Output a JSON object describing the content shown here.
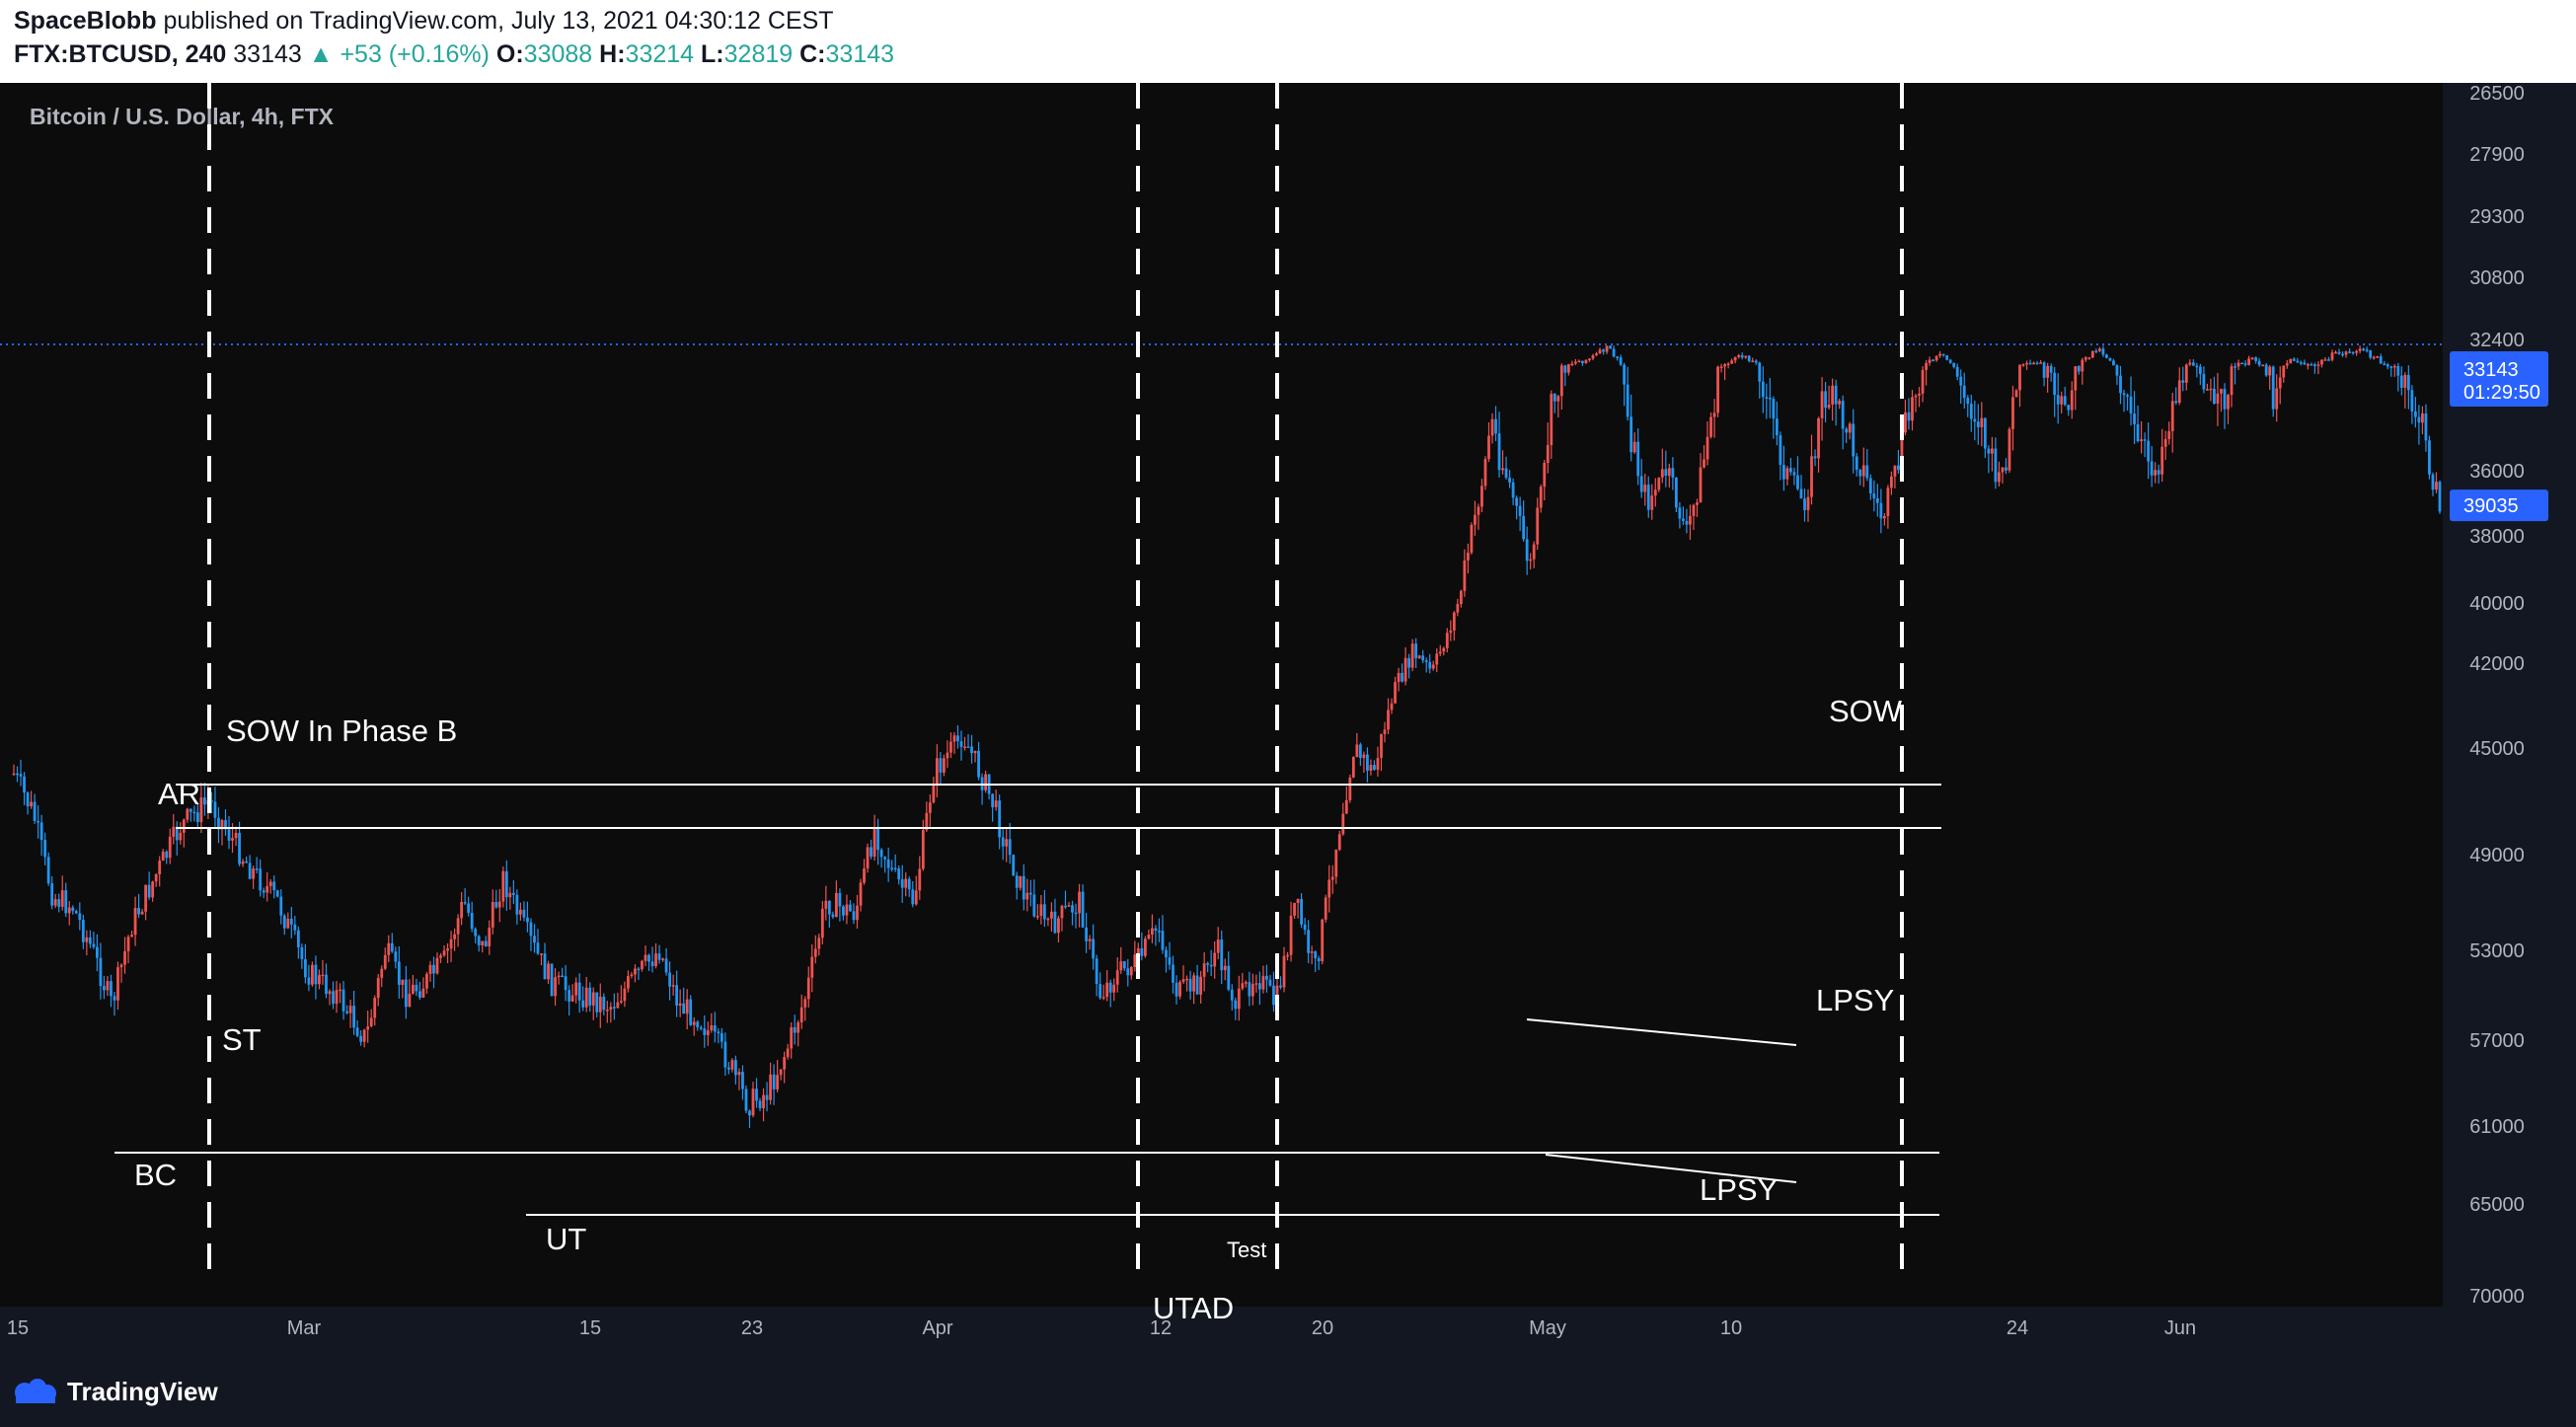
{
  "header": {
    "author": "SpaceBlobb",
    "published_text": "published on TradingView.com, July 13, 2021 04:30:12 CEST",
    "symbol": "FTX:BTCUSD, 240",
    "last": "33143",
    "change": "▲ +53 (+0.16%)",
    "o_label": "O:",
    "o_value": "33088",
    "h_label": "H:",
    "h_value": "33214",
    "l_label": "L:",
    "l_value": "32819",
    "c_label": "C:",
    "c_value": "33143"
  },
  "chart_data": {
    "type": "candlestick",
    "title": "Bitcoin / U.S. Dollar, 4h, FTX",
    "y_axis_inverted": true,
    "y_ticks": [
      26500,
      27900,
      29300,
      30800,
      32400,
      36000,
      38000,
      40000,
      42000,
      45000,
      49000,
      53000,
      57000,
      61000,
      65000,
      70000
    ],
    "x_ticks": [
      "15",
      "Mar",
      "15",
      "23",
      "Apr",
      "12",
      "20",
      "May",
      "10",
      "24",
      "Jun"
    ],
    "current_price": {
      "value": "33143",
      "countdown": "01:29:50"
    },
    "marker_price": "39035",
    "price_waypoints": [
      [
        0,
        50000
      ],
      [
        0.02,
        51500
      ],
      [
        0.04,
        54800
      ],
      [
        0.06,
        55200
      ],
      [
        0.08,
        57000
      ],
      [
        0.1,
        59500
      ],
      [
        0.12,
        56000
      ],
      [
        0.15,
        53500
      ],
      [
        0.17,
        52000
      ],
      [
        0.2,
        51000
      ],
      [
        0.24,
        53500
      ],
      [
        0.27,
        55000
      ],
      [
        0.3,
        58000
      ],
      [
        0.33,
        59000
      ],
      [
        0.36,
        61000
      ],
      [
        0.38,
        57000
      ],
      [
        0.4,
        59000
      ],
      [
        0.42,
        58500
      ],
      [
        0.44,
        57500
      ],
      [
        0.46,
        55000
      ],
      [
        0.48,
        57000
      ],
      [
        0.5,
        54000
      ],
      [
        0.52,
        56000
      ],
      [
        0.55,
        58500
      ],
      [
        0.58,
        59000
      ],
      [
        0.61,
        59500
      ],
      [
        0.64,
        58000
      ],
      [
        0.66,
        57000
      ],
      [
        0.68,
        59500
      ],
      [
        0.7,
        60000
      ],
      [
        0.73,
        62000
      ],
      [
        0.75,
        64000
      ],
      [
        0.77,
        63500
      ],
      [
        0.79,
        61500
      ],
      [
        0.81,
        59000
      ],
      [
        0.83,
        55000
      ],
      [
        0.86,
        55500
      ],
      [
        0.88,
        52000
      ],
      [
        0.9,
        54000
      ],
      [
        0.92,
        55000
      ],
      [
        0.94,
        50000
      ],
      [
        0.97,
        48500
      ],
      [
        1.0,
        51000
      ],
      [
        1.03,
        54500
      ],
      [
        1.06,
        56000
      ],
      [
        1.09,
        55000
      ],
      [
        1.11,
        59000
      ],
      [
        1.13,
        58000
      ],
      [
        1.15,
        57500
      ],
      [
        1.17,
        56000
      ],
      [
        1.19,
        59000
      ],
      [
        1.21,
        58500
      ],
      [
        1.23,
        57000
      ],
      [
        1.25,
        59500
      ],
      [
        1.27,
        58000
      ],
      [
        1.29,
        59500
      ],
      [
        1.31,
        55000
      ],
      [
        1.33,
        58000
      ],
      [
        1.35,
        53000
      ],
      [
        1.37,
        49000
      ],
      [
        1.39,
        50000
      ],
      [
        1.41,
        46500
      ],
      [
        1.43,
        44500
      ],
      [
        1.45,
        45500
      ],
      [
        1.47,
        43000
      ],
      [
        1.49,
        40000
      ],
      [
        1.51,
        37000
      ],
      [
        1.53,
        38500
      ],
      [
        1.55,
        41000
      ],
      [
        1.57,
        37000
      ],
      [
        1.59,
        35500
      ],
      [
        1.61,
        35000
      ],
      [
        1.63,
        33500
      ],
      [
        1.65,
        37000
      ],
      [
        1.67,
        39000
      ],
      [
        1.69,
        38000
      ],
      [
        1.71,
        40000
      ],
      [
        1.73,
        37500
      ],
      [
        1.75,
        35500
      ],
      [
        1.77,
        34500
      ],
      [
        1.79,
        36500
      ],
      [
        1.81,
        38000
      ],
      [
        1.83,
        39000
      ],
      [
        1.85,
        36500
      ],
      [
        1.87,
        37000
      ],
      [
        1.89,
        38000
      ],
      [
        1.91,
        39500
      ],
      [
        1.93,
        37500
      ],
      [
        1.95,
        36000
      ],
      [
        1.97,
        34500
      ],
      [
        1.99,
        36500
      ],
      [
        2.01,
        37000
      ],
      [
        2.03,
        38500
      ],
      [
        2.05,
        36000
      ],
      [
        2.07,
        35500
      ],
      [
        2.09,
        37000
      ],
      [
        2.11,
        36000
      ],
      [
        2.13,
        33500
      ],
      [
        2.15,
        36000
      ],
      [
        2.17,
        37500
      ],
      [
        2.19,
        38000
      ],
      [
        2.21,
        36500
      ],
      [
        2.23,
        35500
      ],
      [
        2.25,
        37000
      ],
      [
        2.27,
        36000
      ],
      [
        2.29,
        35000
      ],
      [
        2.31,
        36500
      ],
      [
        2.33,
        35000
      ],
      [
        2.35,
        36000
      ],
      [
        2.37,
        34500
      ],
      [
        2.4,
        33800
      ],
      [
        2.43,
        36000
      ],
      [
        2.46,
        37000
      ],
      [
        2.48,
        39000
      ]
    ],
    "phase_lines": [
      "",
      "",
      "",
      "",
      ""
    ],
    "annotations": [
      {
        "text": "SOW In Phase B",
        "size": "lg"
      },
      {
        "text": "AR",
        "size": "lg"
      },
      {
        "text": "ST",
        "size": "lg"
      },
      {
        "text": "BC",
        "size": "lg"
      },
      {
        "text": "UT",
        "size": "lg"
      },
      {
        "text": "Test",
        "size": "sm"
      },
      {
        "text": "UTAD",
        "size": "lg"
      },
      {
        "text": "LPSY",
        "size": "lg"
      },
      {
        "text": "LPSY",
        "size": "lg"
      },
      {
        "text": "SOW",
        "size": "lg"
      }
    ],
    "grid": false,
    "up_color": "#ef5350",
    "down_color": "#2196f3",
    "accent_color": "#2962ff"
  },
  "footer": {
    "brand": "TradingView"
  }
}
